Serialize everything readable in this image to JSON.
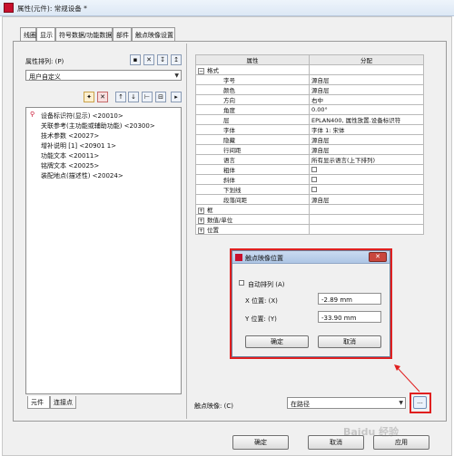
{
  "window": {
    "title": "属性(元件): 常规设备 *"
  },
  "tabs": [
    {
      "label": "线圈"
    },
    {
      "label": "显示"
    },
    {
      "label": "符号数据/功能数据"
    },
    {
      "label": "部件"
    },
    {
      "label": "触点映像设置"
    }
  ],
  "left": {
    "sort_label": "属性排列: (P)",
    "sort_value": "用户自定义",
    "tree_items": [
      {
        "label": "设备标识符(显示) <20010>"
      },
      {
        "label": "关联参考(主功能或辅助功能) <20300>"
      },
      {
        "label": "技术参数 <20027>"
      },
      {
        "label": "增补说明 [1] <20901 1>"
      },
      {
        "label": "功能文本 <20011>"
      },
      {
        "label": "铭牌文本 <20025>"
      },
      {
        "label": "装配地点(描述性) <20024>"
      }
    ],
    "bottom_tabs": [
      {
        "label": "元件"
      },
      {
        "label": "连接点"
      }
    ]
  },
  "grid": {
    "headers": [
      "属性",
      "分配"
    ],
    "rows": [
      {
        "name": "格式",
        "value": "",
        "type": "group",
        "sign": "−"
      },
      {
        "name": "字号",
        "value": "源自层"
      },
      {
        "name": "颜色",
        "value": "源自层"
      },
      {
        "name": "方向",
        "value": "右中"
      },
      {
        "name": "角度",
        "value": "0.00°"
      },
      {
        "name": "层",
        "value": "EPLAN400, 属性放置.设备标识符"
      },
      {
        "name": "字体",
        "value": "字体 1: 宋体"
      },
      {
        "name": "隐藏",
        "value": "源自层"
      },
      {
        "name": "行间距",
        "value": "源自层"
      },
      {
        "name": "语言",
        "value": "所有显示语言(上下排列)"
      },
      {
        "name": "粗体",
        "value": "",
        "type": "check"
      },
      {
        "name": "斜体",
        "value": "",
        "type": "check"
      },
      {
        "name": "下划线",
        "value": "",
        "type": "check"
      },
      {
        "name": "段落间距",
        "value": "源自层"
      },
      {
        "name": "框",
        "value": "",
        "type": "group",
        "sign": "+"
      },
      {
        "name": "数值/单位",
        "value": "",
        "type": "group",
        "sign": "+"
      },
      {
        "name": "位置",
        "value": "",
        "type": "group",
        "sign": "+"
      }
    ]
  },
  "dialog": {
    "title": "触点映像位置",
    "auto_arrange_label": "自动排列 (A)",
    "x_label": "X 位置: (X)",
    "x_value": "-2.89 mm",
    "y_label": "Y 位置: (Y)",
    "y_value": "-33.90 mm",
    "ok": "确定",
    "cancel": "取消"
  },
  "contact_image": {
    "label": "触点映像: (C)",
    "value": "在路径",
    "more": "..."
  },
  "footer": {
    "ok": "确定",
    "cancel": "取消",
    "apply": "应用"
  },
  "watermark": "Baidu 经验"
}
